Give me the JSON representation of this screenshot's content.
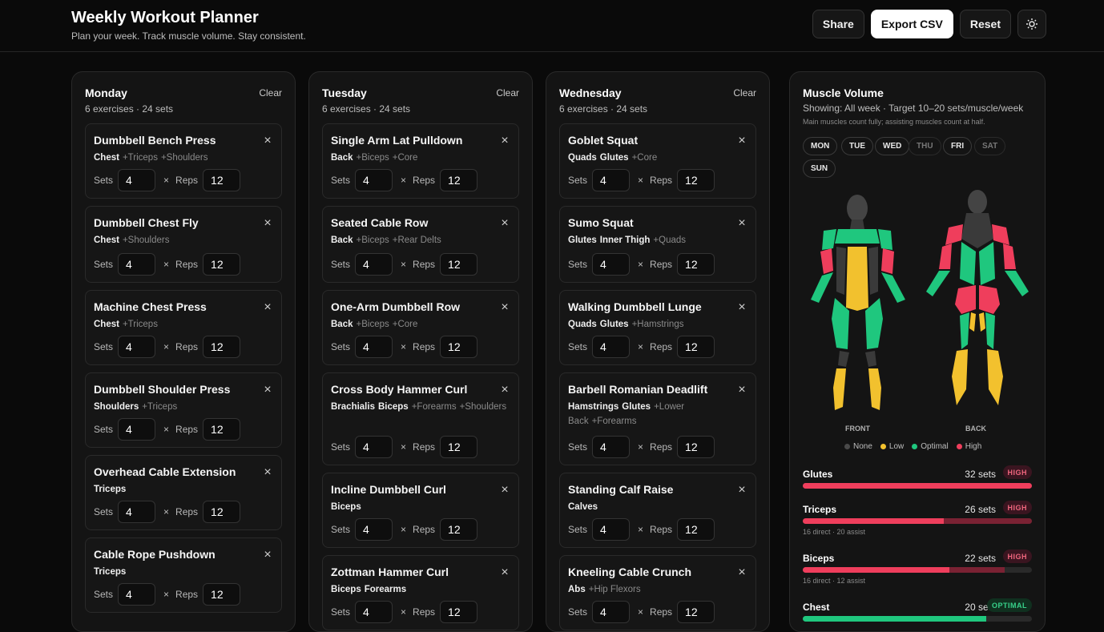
{
  "app": {
    "title": "Weekly Workout Planner",
    "subtitle": "Plan your week. Track muscle volume. Stay consistent.",
    "actions": {
      "share": "Share",
      "export": "Export CSV",
      "reset": "Reset",
      "theme_icon": "sun-icon"
    }
  },
  "labels": {
    "sets": "Sets",
    "reps": "Reps",
    "times": "×",
    "clear": "Clear",
    "close": "×"
  },
  "days": [
    {
      "name": "Monday",
      "meta": "6 exercises · 24 sets",
      "exercises": [
        {
          "name": "Dumbbell Bench Press",
          "main": [
            "Chest"
          ],
          "assist": [
            "+Triceps",
            "+Shoulders"
          ],
          "sets": "4",
          "reps": "12"
        },
        {
          "name": "Dumbbell Chest Fly",
          "main": [
            "Chest"
          ],
          "assist": [
            "+Shoulders"
          ],
          "sets": "4",
          "reps": "12"
        },
        {
          "name": "Machine Chest Press",
          "main": [
            "Chest"
          ],
          "assist": [
            "+Triceps"
          ],
          "sets": "4",
          "reps": "12"
        },
        {
          "name": "Dumbbell Shoulder Press",
          "main": [
            "Shoulders"
          ],
          "assist": [
            "+Triceps"
          ],
          "sets": "4",
          "reps": "12"
        },
        {
          "name": "Overhead Cable Extension",
          "main": [
            "Triceps"
          ],
          "assist": [],
          "sets": "4",
          "reps": "12"
        },
        {
          "name": "Cable Rope Pushdown",
          "main": [
            "Triceps"
          ],
          "assist": [],
          "sets": "4",
          "reps": "12"
        }
      ]
    },
    {
      "name": "Tuesday",
      "meta": "6 exercises · 24 sets",
      "exercises": [
        {
          "name": "Single Arm Lat Pulldown",
          "main": [
            "Back"
          ],
          "assist": [
            "+Biceps",
            "+Core"
          ],
          "sets": "4",
          "reps": "12"
        },
        {
          "name": "Seated Cable Row",
          "main": [
            "Back"
          ],
          "assist": [
            "+Biceps",
            "+Rear Delts"
          ],
          "sets": "4",
          "reps": "12"
        },
        {
          "name": "One-Arm Dumbbell Row",
          "main": [
            "Back"
          ],
          "assist": [
            "+Biceps",
            "+Core"
          ],
          "sets": "4",
          "reps": "12"
        },
        {
          "name": "Cross Body Hammer Curl",
          "main": [
            "Brachialis",
            "Biceps"
          ],
          "assist": [
            "+Forearms",
            "+Shoulders"
          ],
          "sets": "4",
          "reps": "12"
        },
        {
          "name": "Incline Dumbbell Curl",
          "main": [
            "Biceps"
          ],
          "assist": [],
          "sets": "4",
          "reps": "12"
        },
        {
          "name": "Zottman Hammer Curl",
          "main": [
            "Biceps",
            "Forearms"
          ],
          "assist": [],
          "sets": "4",
          "reps": "12"
        }
      ]
    },
    {
      "name": "Wednesday",
      "meta": "6 exercises · 24 sets",
      "exercises": [
        {
          "name": "Goblet Squat",
          "main": [
            "Quads",
            "Glutes"
          ],
          "assist": [
            "+Core"
          ],
          "sets": "4",
          "reps": "12"
        },
        {
          "name": "Sumo Squat",
          "main": [
            "Glutes",
            "Inner Thigh"
          ],
          "assist": [
            "+Quads"
          ],
          "sets": "4",
          "reps": "12"
        },
        {
          "name": "Walking Dumbbell Lunge",
          "main": [
            "Quads",
            "Glutes"
          ],
          "assist": [
            "+Hamstrings"
          ],
          "sets": "4",
          "reps": "12"
        },
        {
          "name": "Barbell Romanian Deadlift",
          "main": [
            "Hamstrings",
            "Glutes"
          ],
          "assist": [
            "+Lower Back",
            "+Forearms"
          ],
          "sets": "4",
          "reps": "12"
        },
        {
          "name": "Standing Calf Raise",
          "main": [
            "Calves"
          ],
          "assist": [],
          "sets": "4",
          "reps": "12"
        },
        {
          "name": "Kneeling Cable Crunch",
          "main": [
            "Abs"
          ],
          "assist": [
            "+Hip Flexors"
          ],
          "sets": "4",
          "reps": "12"
        }
      ]
    }
  ],
  "volume": {
    "title": "Muscle Volume",
    "subtitle": "Showing: All week · Target 10–20 sets/muscle/week",
    "note": "Main muscles count fully; assisting muscles count at half.",
    "day_filters": [
      {
        "label": "MON",
        "active": true
      },
      {
        "label": "TUE",
        "active": true
      },
      {
        "label": "WED",
        "active": true
      },
      {
        "label": "THU",
        "active": false
      },
      {
        "label": "FRI",
        "active": true
      },
      {
        "label": "SAT",
        "active": false
      },
      {
        "label": "SUN",
        "active": true
      }
    ],
    "front_label": "FRONT",
    "back_label": "BACK",
    "legend": [
      {
        "label": "None",
        "color": "#4a4a4a"
      },
      {
        "label": "Low",
        "color": "#f2c12e"
      },
      {
        "label": "Optimal",
        "color": "#1fc77e"
      },
      {
        "label": "High",
        "color": "#ef3e5c"
      }
    ],
    "muscles": [
      {
        "name": "Glutes",
        "sets": "32 sets",
        "badge": "HIGH",
        "level": "high",
        "direct_fraction": 1.0,
        "assist_fraction": 0.0,
        "sub": ""
      },
      {
        "name": "Triceps",
        "sets": "26 sets",
        "badge": "HIGH",
        "level": "high",
        "direct_fraction": 0.615,
        "assist_fraction": 0.385,
        "sub": "16 direct · 20 assist"
      },
      {
        "name": "Biceps",
        "sets": "22 sets",
        "badge": "HIGH",
        "level": "high",
        "direct_fraction": 0.64,
        "assist_fraction": 0.24,
        "sub": "16 direct · 12 assist"
      },
      {
        "name": "Chest",
        "sets": "20 sets",
        "badge": "OPTIMAL",
        "level": "optimal",
        "direct_fraction": 0.8,
        "assist_fraction": 0.0,
        "sub": ""
      }
    ],
    "colors": {
      "high": "#ef3e5c",
      "high_assist": "#7a2233",
      "optimal": "#1fc77e",
      "low": "#f2c12e",
      "none": "#333333"
    }
  }
}
